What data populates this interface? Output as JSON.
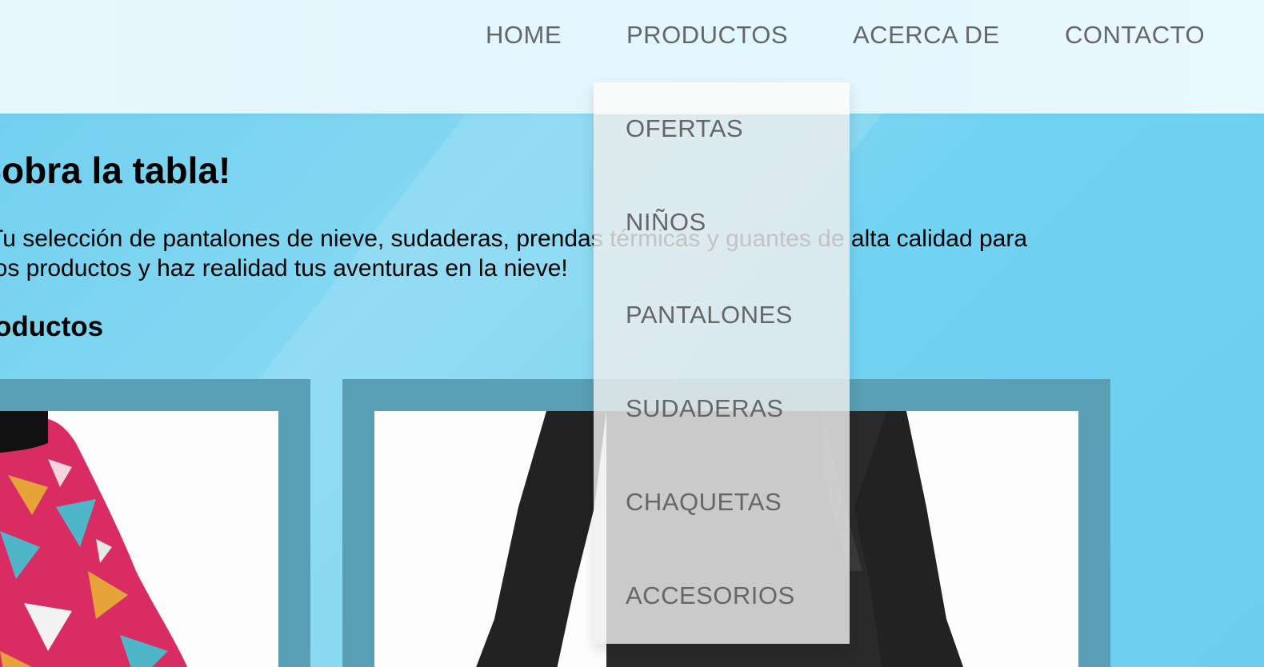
{
  "nav": {
    "items": [
      {
        "label": "HOME"
      },
      {
        "label": "PRODUCTOS"
      },
      {
        "label": "ACERCA DE"
      },
      {
        "label": "CONTACTO"
      }
    ]
  },
  "dropdown": {
    "items": [
      {
        "label": "OFERTAS"
      },
      {
        "label": "NIÑOS"
      },
      {
        "label": "PANTALONES"
      },
      {
        "label": "SUDADERAS"
      },
      {
        "label": "CHAQUETAS"
      },
      {
        "label": "ACCESORIOS"
      }
    ]
  },
  "hero": {
    "title": "¡Sobra la tabla!",
    "text_line1": "Tu selección de pantalones de nieve, sudaderas, prendas térmicas y guantes de alta calidad para",
    "text_line2": "los productos y haz realidad tus aventuras en la nieve!"
  },
  "products_section": {
    "title": "Productos"
  },
  "colors": {
    "header_bg": "#e4f7fd",
    "hero_bg": "#7dd4f0",
    "card_frame": "#5a9fb5",
    "nav_text": "#666666",
    "dropdown_bg": "#eeeeee"
  }
}
